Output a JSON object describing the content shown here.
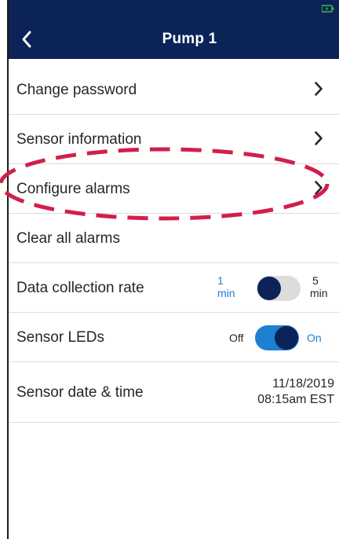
{
  "header": {
    "title": "Pump 1",
    "back_icon": "chevron-left-icon",
    "battery_icon": "battery-charging-icon",
    "colors": {
      "navbar": "#0b2357",
      "battery": "#3cbf3c"
    }
  },
  "menu": {
    "change_password": {
      "label": "Change password",
      "icon": "chevron-right-icon"
    },
    "sensor_information": {
      "label": "Sensor information",
      "icon": "chevron-right-icon"
    },
    "configure_alarms": {
      "label": "Configure alarms",
      "icon": "chevron-right-icon"
    },
    "clear_alarms": {
      "label": "Clear all alarms"
    },
    "data_collection_rate": {
      "label": "Data collection rate",
      "option_left_value": "1",
      "option_left_unit": "min",
      "option_right_value": "5",
      "option_right_unit": "min",
      "selected": "1 min"
    },
    "sensor_leds": {
      "label": "Sensor LEDs",
      "off_label": "Off",
      "on_label": "On",
      "state": "on"
    },
    "sensor_datetime": {
      "label": "Sensor date & time",
      "date": "11/18/2019",
      "time": "08:15am EST"
    }
  },
  "annotation": {
    "highlight_target": "Configure alarms",
    "color": "#d21f4a"
  },
  "colors": {
    "accent_blue": "#1f7fd0",
    "dark_navy": "#0b2357"
  }
}
